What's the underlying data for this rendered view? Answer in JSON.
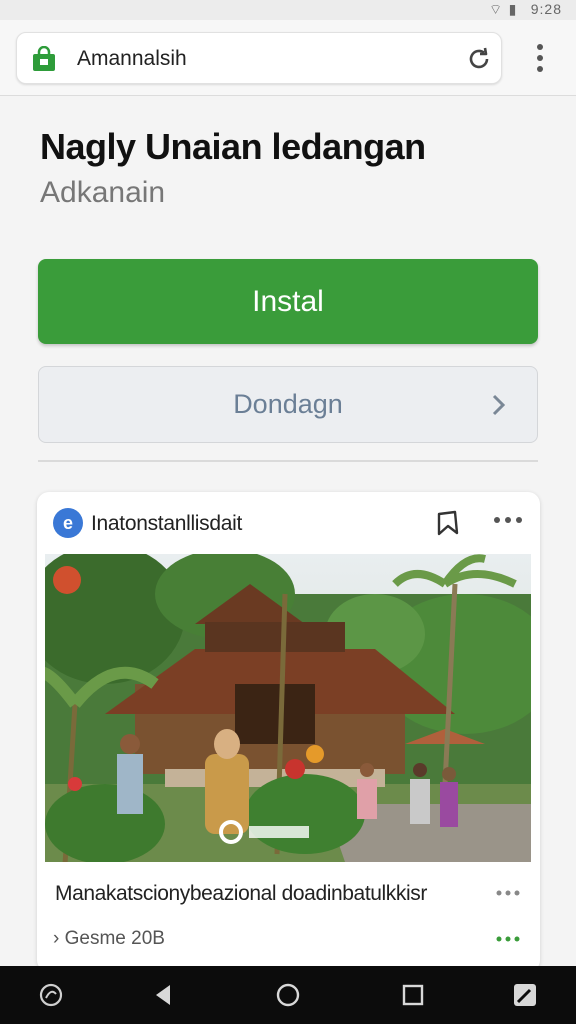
{
  "status_bar": {
    "time": "9:28"
  },
  "browser": {
    "url": "Amannalsih"
  },
  "app": {
    "title": "Nagly Unaian ledangan",
    "subtitle": "Adkanain",
    "install_label": "Instal",
    "secondary_label": "Dondagn"
  },
  "card": {
    "source": "Inatonstanllisdait",
    "caption": "Manakatscionybeazional doadinbatulkkisr",
    "meta": "Gesme 20B"
  },
  "colors": {
    "install": "#3a9c3a",
    "secondary_text": "#6b7f96",
    "source_icon": "#3a78d6"
  },
  "icons": {
    "url": "shopping-bag-icon",
    "reload": "reload-icon",
    "menu": "more-vertical-icon",
    "bookmark": "bookmark-icon",
    "more": "more-horizontal-icon"
  }
}
